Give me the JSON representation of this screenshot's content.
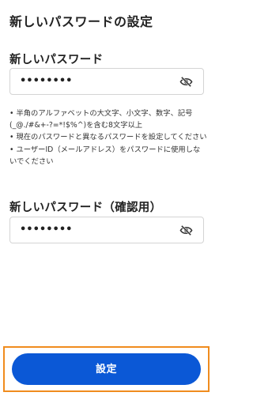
{
  "title": "新しいパスワードの設定",
  "new_password": {
    "label": "新しいパスワード",
    "value": "••••••••",
    "toggle_icon": "eye-off-icon"
  },
  "rules": [
    "• 半角のアルファベットの大文字、小文字、数字、記号(_@./#&+-?=*!$%^)を含む8文字以上",
    "• 現在のパスワードと異なるパスワードを設定してください",
    "• ユーザーID（メールアドレス）をパスワードに使用しないでください"
  ],
  "confirm_password": {
    "label": "新しいパスワード（確認用）",
    "value": "••••••••",
    "toggle_icon": "eye-off-icon"
  },
  "submit": {
    "label": "設定"
  },
  "colors": {
    "primary": "#0b58d6",
    "highlight_frame": "#f08c1e",
    "border": "#d4d4d4"
  }
}
